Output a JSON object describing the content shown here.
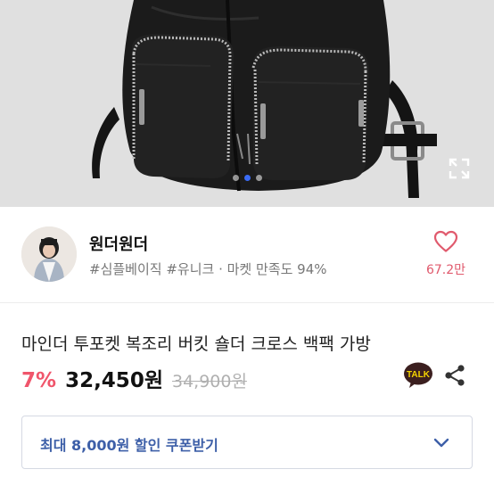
{
  "carousel": {
    "image": "black-leather-backpack-photo",
    "dot_count": 3,
    "active_dot": 1,
    "expand_icon": "expand-icon"
  },
  "shop": {
    "name": "원더원더",
    "tags": "#심플베이직 #유니크 · 마켓 만족도 94%",
    "like_icon": "heart-outline-icon",
    "like_count": "67.2만",
    "accent": "#e05a6d"
  },
  "product": {
    "title": "마인더 투포켓 복조리 버킷 숄더 크로스 백팩 가방",
    "discount": "7%",
    "price": "32,450원",
    "original_price": "34,900원",
    "discount_color": "#f0556b",
    "talk_label": "TALK",
    "talk_icon": "kakaotalk-icon",
    "share_icon": "share-icon"
  },
  "coupon": {
    "label": "최대 8,000원 할인 쿠폰받기",
    "chevron_icon": "chevron-down-icon",
    "label_color": "#3d5fa8"
  }
}
